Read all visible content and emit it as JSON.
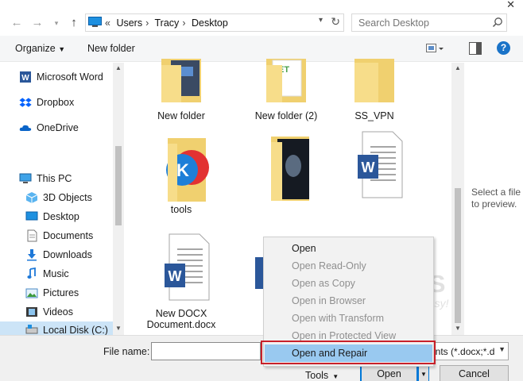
{
  "window": {
    "close_glyph": "✕"
  },
  "address": {
    "crumbs": [
      "«",
      "Users",
      "Tracy",
      "Desktop"
    ],
    "search_placeholder": "Search Desktop"
  },
  "toolbar": {
    "organize": "Organize",
    "new_folder": "New folder",
    "help": "?"
  },
  "nav": {
    "items": [
      {
        "label": "Microsoft Word",
        "icon": "word-icon"
      },
      {
        "label": "Dropbox",
        "icon": "dropbox-icon"
      },
      {
        "label": "OneDrive",
        "icon": "onedrive-icon"
      },
      {
        "label": "This PC",
        "icon": "pc-icon"
      },
      {
        "label": "3D Objects",
        "icon": "3d-objects-icon"
      },
      {
        "label": "Desktop",
        "icon": "desktop-icon"
      },
      {
        "label": "Documents",
        "icon": "documents-icon"
      },
      {
        "label": "Downloads",
        "icon": "downloads-icon"
      },
      {
        "label": "Music",
        "icon": "music-icon"
      },
      {
        "label": "Pictures",
        "icon": "pictures-icon"
      },
      {
        "label": "Videos",
        "icon": "videos-icon"
      },
      {
        "label": "Local Disk (C:)",
        "icon": "disk-icon"
      }
    ]
  },
  "files": [
    {
      "name": "New folder",
      "type": "folder"
    },
    {
      "name": "New folder (2)",
      "type": "folder"
    },
    {
      "name": "SS_VPN",
      "type": "folder"
    },
    {
      "name": "tools",
      "type": "folder"
    },
    {
      "name": "",
      "type": "folder"
    },
    {
      "name": "",
      "type": "word-document"
    },
    {
      "name": "New DOCX Document.docx",
      "type": "word-document"
    }
  ],
  "preview": {
    "text": "Select a file to preview."
  },
  "watermark": {
    "title": "EaseUS",
    "subtitle": "Make your life easy!"
  },
  "bottom": {
    "file_name_label": "File name:",
    "file_name_value": "",
    "file_type": "ents (*.docx;*.d",
    "tools": "Tools",
    "open": "Open",
    "cancel": "Cancel"
  },
  "open_menu": {
    "items": [
      {
        "label": "Open",
        "enabled": true
      },
      {
        "label": "Open Read-Only",
        "enabled": false
      },
      {
        "label": "Open as Copy",
        "enabled": false
      },
      {
        "label": "Open in Browser",
        "enabled": false
      },
      {
        "label": "Open with Transform",
        "enabled": false
      },
      {
        "label": "Open in Protected View",
        "enabled": false
      },
      {
        "label": "Open and Repair",
        "enabled": true,
        "highlighted": true
      }
    ]
  },
  "colors": {
    "accent": "#0078d7",
    "highlight_border": "#c8202a",
    "menu_hover": "#99c9f0",
    "selected_nav": "#cce4f7"
  }
}
